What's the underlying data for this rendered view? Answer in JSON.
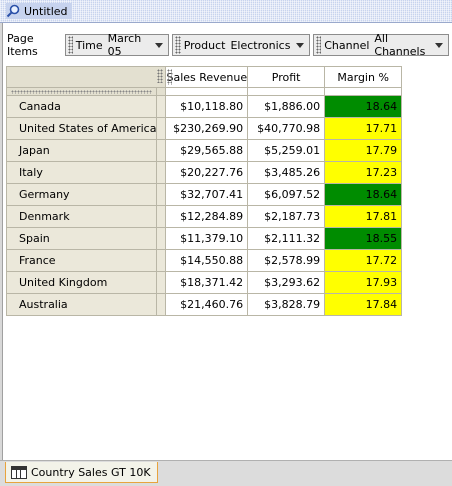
{
  "window": {
    "title": "Untitled"
  },
  "page_items": {
    "label": "Page Items",
    "items": [
      {
        "dimension": "Time",
        "value": "March 05"
      },
      {
        "dimension": "Product",
        "value": "Electronics"
      },
      {
        "dimension": "Channel",
        "value": "All Channels"
      }
    ]
  },
  "crosstab": {
    "columns": [
      "Sales Revenue",
      "Profit",
      "Margin %"
    ],
    "rows": [
      {
        "country": "Canada",
        "sales": "$10,118.80",
        "profit": "$1,886.00",
        "margin": "18.64",
        "status": "green"
      },
      {
        "country": "United States of America",
        "sales": "$230,269.90",
        "profit": "$40,770.98",
        "margin": "17.71",
        "status": "yellow"
      },
      {
        "country": "Japan",
        "sales": "$29,565.88",
        "profit": "$5,259.01",
        "margin": "17.79",
        "status": "yellow"
      },
      {
        "country": "Italy",
        "sales": "$20,227.76",
        "profit": "$3,485.26",
        "margin": "17.23",
        "status": "yellow"
      },
      {
        "country": "Germany",
        "sales": "$32,707.41",
        "profit": "$6,097.52",
        "margin": "18.64",
        "status": "green"
      },
      {
        "country": "Denmark",
        "sales": "$12,284.89",
        "profit": "$2,187.73",
        "margin": "17.81",
        "status": "yellow"
      },
      {
        "country": "Spain",
        "sales": "$11,379.10",
        "profit": "$2,111.32",
        "margin": "18.55",
        "status": "green"
      },
      {
        "country": "France",
        "sales": "$14,550.88",
        "profit": "$2,578.99",
        "margin": "17.72",
        "status": "yellow"
      },
      {
        "country": "United Kingdom",
        "sales": "$18,371.42",
        "profit": "$3,293.62",
        "margin": "17.93",
        "status": "yellow"
      },
      {
        "country": "Australia",
        "sales": "$21,460.76",
        "profit": "$3,828.79",
        "margin": "17.84",
        "status": "yellow"
      }
    ],
    "status_colors": {
      "green": "#008c00",
      "yellow": "#ffff00"
    }
  },
  "sheet_tabs": [
    {
      "label": "Country Sales GT 10K",
      "icon": "crosstab-icon"
    }
  ]
}
